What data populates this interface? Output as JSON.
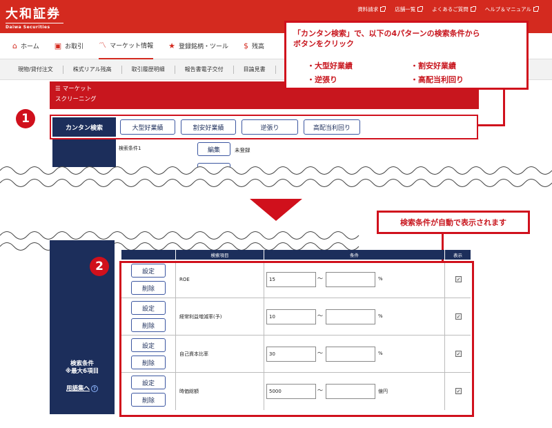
{
  "header": {
    "logo_main": "大和証券",
    "logo_sub": "Daiwa Securities",
    "links": [
      "資料請求",
      "店舗一覧",
      "よくあるご質問",
      "ヘルプ＆マニュアル"
    ]
  },
  "gnav": [
    {
      "label": "ホーム",
      "icon": "home-icon"
    },
    {
      "label": "お取引",
      "icon": "trade-icon"
    },
    {
      "label": "マーケット情報",
      "icon": "market-icon"
    },
    {
      "label": "登録銘柄・ツール",
      "icon": "star-icon"
    },
    {
      "label": "残高",
      "icon": "yen-icon"
    }
  ],
  "subnav": [
    "現物/貸付注文",
    "株式リアル残高",
    "取引履歴明細",
    "報告書電子交付",
    "目論見書"
  ],
  "panel": {
    "crumb": "マーケット",
    "title": "スクリーニング",
    "easy_label": "カンタン検索",
    "easy_buttons": [
      "大型好業績",
      "割安好業績",
      "逆張り",
      "高配当利回り"
    ],
    "condition_label": "検索条件1",
    "edit_label": "編集",
    "status": "未登録"
  },
  "callout_top": {
    "title_line1": "「カンタン検索」で、以下の4パターンの検索条件から",
    "title_line2": "ボタンをクリック",
    "items": [
      "・大型好業績",
      "・割安好業績",
      "・逆張り",
      "・高配当利回り"
    ]
  },
  "callout_bottom": "検索条件が自動で表示されます",
  "badges": [
    "1",
    "2"
  ],
  "table": {
    "headers": [
      "",
      "検索項目",
      "条件",
      "表示"
    ],
    "set_label": "設定",
    "delete_label": "削除",
    "tilde": "〜",
    "rows": [
      {
        "item": "ROE",
        "min": "15",
        "unit": "%"
      },
      {
        "item": "経常利益増減率(予)",
        "min": "10",
        "unit": "%"
      },
      {
        "item": "自己資本比率",
        "min": "30",
        "unit": "%"
      },
      {
        "item": "時価総額",
        "min": "5000",
        "unit": "億円"
      }
    ]
  },
  "sidebar": {
    "label_line1": "検索条件",
    "label_line2": "※最大6項目",
    "glossary": "用語集へ",
    "help": "?"
  }
}
